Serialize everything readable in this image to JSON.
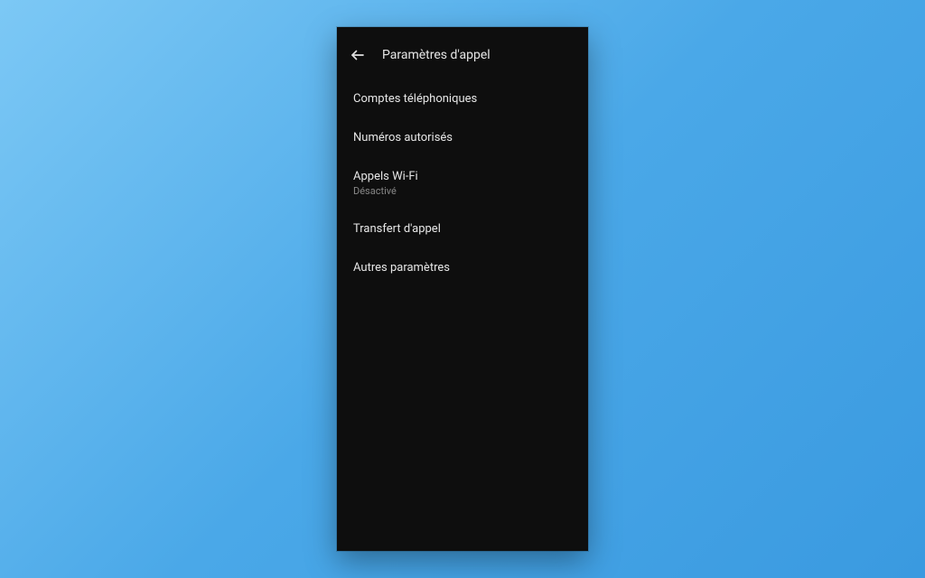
{
  "header": {
    "title": "Paramètres d'appel"
  },
  "items": [
    {
      "title": "Comptes téléphoniques",
      "subtitle": ""
    },
    {
      "title": "Numéros autorisés",
      "subtitle": ""
    },
    {
      "title": "Appels Wi-Fi",
      "subtitle": "Désactivé"
    },
    {
      "title": "Transfert d'appel",
      "subtitle": ""
    },
    {
      "title": "Autres paramètres",
      "subtitle": ""
    }
  ]
}
